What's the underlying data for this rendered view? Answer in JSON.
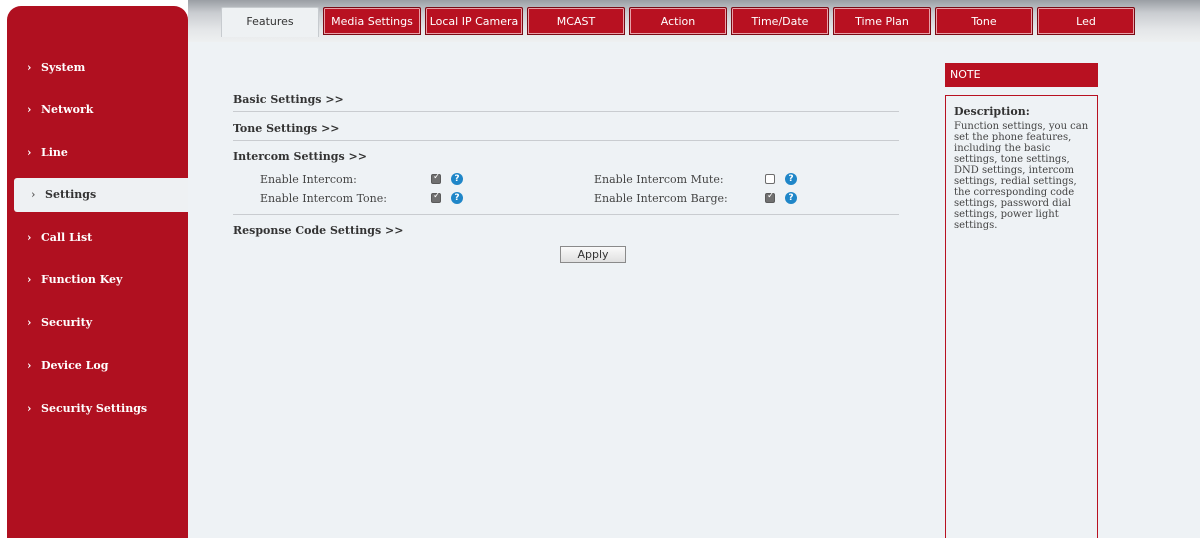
{
  "tabs": [
    {
      "label": "Features",
      "active": true
    },
    {
      "label": "Media Settings",
      "active": false
    },
    {
      "label": "Local IP Camera",
      "active": false
    },
    {
      "label": "MCAST",
      "active": false
    },
    {
      "label": "Action",
      "active": false
    },
    {
      "label": "Time/Date",
      "active": false
    },
    {
      "label": "Time Plan",
      "active": false
    },
    {
      "label": "Tone",
      "active": false
    },
    {
      "label": "Led",
      "active": false
    }
  ],
  "sidebar": {
    "items": [
      {
        "label": "System"
      },
      {
        "label": "Network"
      },
      {
        "label": "Line"
      },
      {
        "label": "Settings",
        "active": true
      },
      {
        "label": "Call List"
      },
      {
        "label": "Function Key"
      },
      {
        "label": "Security"
      },
      {
        "label": "Device Log"
      },
      {
        "label": "Security Settings"
      }
    ],
    "chevron": "›"
  },
  "sections": {
    "basic": "Basic Settings >>",
    "tone": "Tone Settings >>",
    "intercom": "Intercom Settings >>",
    "response": "Response Code Settings >>"
  },
  "intercom": {
    "enable_intercom": {
      "label": "Enable Intercom:",
      "checked": true
    },
    "enable_intercom_tone": {
      "label": "Enable Intercom Tone:",
      "checked": true
    },
    "enable_intercom_mute": {
      "label": "Enable Intercom Mute:",
      "checked": false
    },
    "enable_intercom_barge": {
      "label": "Enable Intercom Barge:",
      "checked": true
    },
    "help_glyph": "?"
  },
  "apply_label": "Apply",
  "note": {
    "header": "NOTE",
    "title": "Description:",
    "text": "Function settings, you can set the phone features, including the basic settings, tone settings, DND settings, intercom settings, redial settings, the corresponding code settings, password dial settings, power light settings."
  },
  "colors": {
    "accent": "#b81121",
    "sidebar": "#b01020",
    "content_bg": "#eef2f5",
    "help": "#1f86c8"
  }
}
